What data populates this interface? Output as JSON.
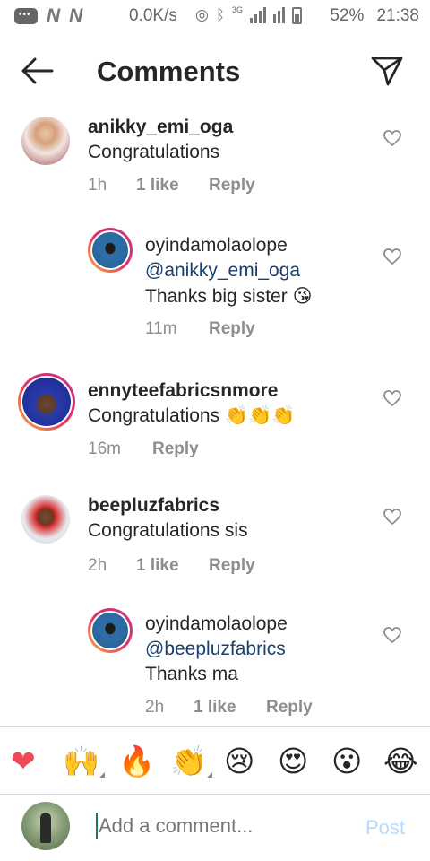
{
  "status_bar": {
    "speed": "0.0K/s",
    "network": "3G",
    "battery": "52%",
    "time": "21:38"
  },
  "header": {
    "title": "Comments"
  },
  "comments": [
    {
      "username": "anikky_emi_oga",
      "text": "Congratulations",
      "time": "1h",
      "likes": "1 like",
      "reply": "Reply"
    },
    {
      "username": "oyindamolaolope",
      "mention": "@anikky_emi_oga",
      "text": "Thanks big sister 😘",
      "time": "11m",
      "reply": "Reply"
    },
    {
      "username": "ennyteefabricsnmore",
      "text": "Congratulations 👏👏👏",
      "time": "16m",
      "reply": "Reply"
    },
    {
      "username": "beepluzfabrics",
      "text": "Congratulations sis",
      "time": "2h",
      "likes": "1 like",
      "reply": "Reply"
    },
    {
      "username": "oyindamolaolope",
      "mention": "@beepluzfabrics",
      "text": "Thanks ma",
      "time": "2h",
      "likes": "1 like",
      "reply": "Reply"
    }
  ],
  "emoji_bar": [
    "❤",
    "🙌",
    "🔥",
    "👏",
    "😢",
    "😍",
    "😮",
    "😂"
  ],
  "composer": {
    "placeholder": "Add a comment...",
    "post_label": "Post"
  },
  "colors": {
    "mention": "#1a3f6f",
    "meta": "#8e8e8e",
    "post_disabled": "#b3dbff",
    "heart_emoji": "#ed4956"
  }
}
